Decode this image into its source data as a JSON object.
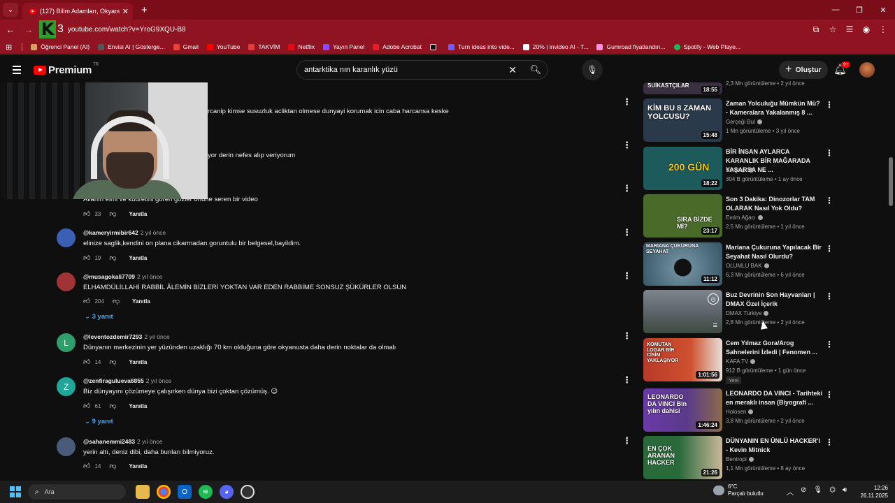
{
  "browser": {
    "tab_title": "(127) Bilim Adamları, Okyanusu...",
    "tab_close": "✕",
    "new_tab": "+",
    "url": "youtube.com/watch?v=YroG9XQU-B8",
    "window_controls": [
      "—",
      "❐",
      "✕"
    ],
    "bookmarks": [
      {
        "label": "Öğrenci Panel (AI)",
        "color": "#d8a064"
      },
      {
        "label": "Envisi AI | Gösterge...",
        "color": "#555555"
      },
      {
        "label": "Gmail",
        "color": "#ea4335"
      },
      {
        "label": "YouTube",
        "color": "#ff0000"
      },
      {
        "label": "TAKVİM",
        "color": "#e83a3a"
      },
      {
        "label": "Netflix",
        "color": "#e50914"
      },
      {
        "label": "Yayın Panel",
        "color": "#9146ff"
      },
      {
        "label": "Adobe Acrobat",
        "color": "#ec1c24"
      },
      {
        "label": "",
        "color": "#111111"
      },
      {
        "label": "Turn ideas into vide...",
        "color": "#6b5cff"
      },
      {
        "label": "20% | invideo AI - T...",
        "color": "#ffffff"
      },
      {
        "label": "Gumroad fiyatlandırı...",
        "color": "#ff90e8"
      },
      {
        "label": "Spotify - Web Playe...",
        "color": "#1db954"
      }
    ]
  },
  "youtube": {
    "brand": "Premium",
    "region": "TR",
    "search_query": "antarktika nın karanlık yüzü",
    "create_label": "Oluştur",
    "notifications": "9+"
  },
  "comments": {
    "fragments": [
      "rcanip kimse susuzluk acliktan olmese dunyayi korumak icin caba harcansa keske",
      "yor derin nefes alıp veriyorum",
      "Allahın elmi ve kudretini gören gözler önüne seren bir video"
    ],
    "first_actions": {
      "likes": "33",
      "reply": "Yanıtla"
    },
    "items": [
      {
        "handle": "@kameryirmibir642",
        "ago": "2 yıl önce",
        "text": "elinize saglik,kendini on plana cikarmadan goruntulu bir  belgesel,bayildim.",
        "likes": "19",
        "reply": "Yanıtla",
        "replies": "",
        "avatar": "",
        "avatar_color": "#3b5fb3"
      },
      {
        "handle": "@musagokali7709",
        "ago": "2 yıl önce",
        "text": "ELHAMDÜLİLLAHİ RABBİL ÂLEMİN BİZLERİ YOKTAN VAR EDEN RABBİME SONSUZ ŞÜKÜRLER OLSUN",
        "likes": "204",
        "reply": "Yanıtla",
        "replies": "3 yanıt",
        "avatar": "",
        "avatar_color": "#a03333"
      },
      {
        "handle": "@leventozdemir7293",
        "ago": "2 yıl önce",
        "text": "Dünyanın merkezinin yer yüzünden uzaklığı 70 km olduğuna göre okyanusta daha derin noktalar da olmalı",
        "likes": "14",
        "reply": "Yanıtla",
        "replies": "",
        "avatar": "L",
        "avatar_color": "#2e9e6a"
      },
      {
        "handle": "@zenfiragulueva6855",
        "ago": "2 yıl önce",
        "text": "Biz dünyayını çözümeye çalışırken dünya bizi çoktan çözümüş. 😉",
        "likes": "61",
        "reply": "Yanıtla",
        "replies": "9 yanıt",
        "avatar": "Z",
        "avatar_color": "#1ea69a"
      },
      {
        "handle": "@sahanemmi2483",
        "ago": "2 yıl önce",
        "text": "yerin altı, deniz dibi, daha bunları bilmiyoruz.",
        "likes": "14",
        "reply": "Yanıtla",
        "replies": "",
        "avatar": "",
        "avatar_color": "#4a5a7a"
      }
    ]
  },
  "sidebar": {
    "top_partial": {
      "thumb_text": "SUİKASTÇILAR",
      "duration": "18:55",
      "meta": "2,3 Mn görüntüleme • 2 yıl önce"
    },
    "items": [
      {
        "title": "Zaman Yolculuğu Mümkün Mü? - Kameralara Yakalanmış 8 ...",
        "channel": "Gerçeği Bul",
        "meta": "1 Mn görüntüleme • 3 yıl önce",
        "duration": "15:48",
        "thumb_text": "KİM BU 8 ZAMAN YOLCUSU?",
        "thumb_color": "#2a3a4a"
      },
      {
        "title": "BİR İNSAN AYLARCA KARANLIK BİR MAĞARADA YAŞARSA NE ...",
        "channel": "Bentropi",
        "meta": "304 B görüntüleme • 1 ay önce",
        "duration": "18:22",
        "thumb_text": "200 GÜN",
        "thumb_color": "#1d5a5c"
      },
      {
        "title": "Son 3 Dakika: Dinozorlar TAM OLARAK Nasıl Yok Oldu?",
        "channel": "Evrim Ağacı",
        "meta": "2,5 Mn görüntüleme • 1 yıl önce",
        "duration": "23:17",
        "thumb_text": "SIRA BİZDE Mİ?",
        "thumb_color": "#4a6a2a"
      },
      {
        "title": "Mariana Çukuruna Yapılacak Bir Seyahat Nasıl Olurdu?",
        "channel": "OLUMLU BAK",
        "meta": "6,3 Mn görüntüleme • 6 yıl önce",
        "duration": "11:12",
        "thumb_text": "MARIANA ÇUKURUNA SEYAHAT",
        "thumb_color": "#3c5a6a"
      },
      {
        "title": "Buz Devrinin Son Hayvanları | DMAX Özel İçerik",
        "channel": "DMAX Türkiye",
        "meta": "2,8 Mn görüntüleme • 2 yıl önce",
        "duration": "",
        "thumb_text": "",
        "thumb_color": "#5a6268"
      },
      {
        "title": "Cem Yılmaz Gora/Arog Sahnelerini İzledi | Fenomen ...",
        "channel": "KAFA TV",
        "meta": "912 B görüntüleme • 1 gün önce",
        "duration": "1:01:56",
        "thumb_text": "KOMUTAN LOGAR BİR CİSİM YAKLAŞIYOR",
        "thumb_color": "#b83a2a",
        "badge": "Yeni"
      },
      {
        "title": "LEONARDO DA VINCI - Tarihteki en meraklı insan (Biyografi ...",
        "channel": "Holosen",
        "meta": "3,8 Mn görüntüleme • 2 yıl önce",
        "duration": "1:46:24",
        "thumb_text": "LEONARDO DA VINCI Bin yılın dahisi",
        "thumb_color": "#6a3aa8"
      },
      {
        "title": "DÜNYANIN EN ÜNLÜ HACKER'I - Kevin Mitnick",
        "channel": "Bentropi",
        "meta": "1,1 Mn görüntüleme • 8 ay önce",
        "duration": "21:26",
        "thumb_text": "EN ÇOK ARANAN HACKER",
        "thumb_color": "#2a6a3a"
      }
    ]
  },
  "taskbar": {
    "search_placeholder": "Ara",
    "weather_temp": "6°C",
    "weather_desc": "Parçalı bulutlu",
    "time": "12:26",
    "date": "26.11.2025"
  }
}
